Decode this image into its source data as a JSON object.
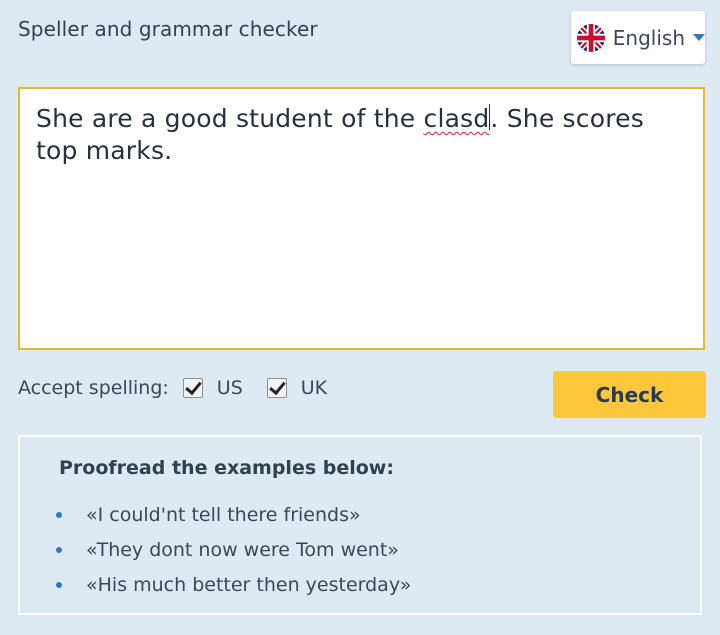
{
  "header": {
    "title": "Speller and grammar checker"
  },
  "language": {
    "label": "English",
    "flag_icon": "uk-flag-icon",
    "caret_icon": "chevron-down-icon"
  },
  "editor": {
    "text_before": "She are a good student of the ",
    "misspelled_word": "clasd",
    "text_after": ". She scores top marks."
  },
  "spelling": {
    "label": "Accept spelling:",
    "options": [
      {
        "label": "US",
        "checked": true
      },
      {
        "label": "UK",
        "checked": true
      }
    ]
  },
  "check_button": {
    "label": "Check"
  },
  "examples": {
    "title": "Proofread the examples below:",
    "items": [
      "«I could'nt tell there friends»",
      "«They dont now were Tom went»",
      "«His much better then yesterday»"
    ]
  },
  "colors": {
    "accent": "#2b78c5",
    "button": "#fec63b",
    "editor_border": "#e6b733",
    "background": "#dde9f3"
  }
}
